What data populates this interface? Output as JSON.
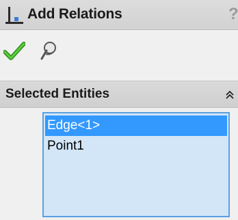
{
  "panel": {
    "title": "Add Relations",
    "help_glyph": "?"
  },
  "toolbar": {
    "icons": [
      "ok-checkmark-icon",
      "pushpin-icon"
    ]
  },
  "selected_entities": {
    "header": "Selected Entities",
    "items": [
      {
        "label": "Edge<1>",
        "selected": true
      },
      {
        "label": "Point1",
        "selected": false
      }
    ]
  },
  "colors": {
    "selection_highlight": "#3399ff",
    "list_background": "#d2e6f8",
    "list_border": "#5aa0e0",
    "checkmark": "#3aaa2a"
  }
}
